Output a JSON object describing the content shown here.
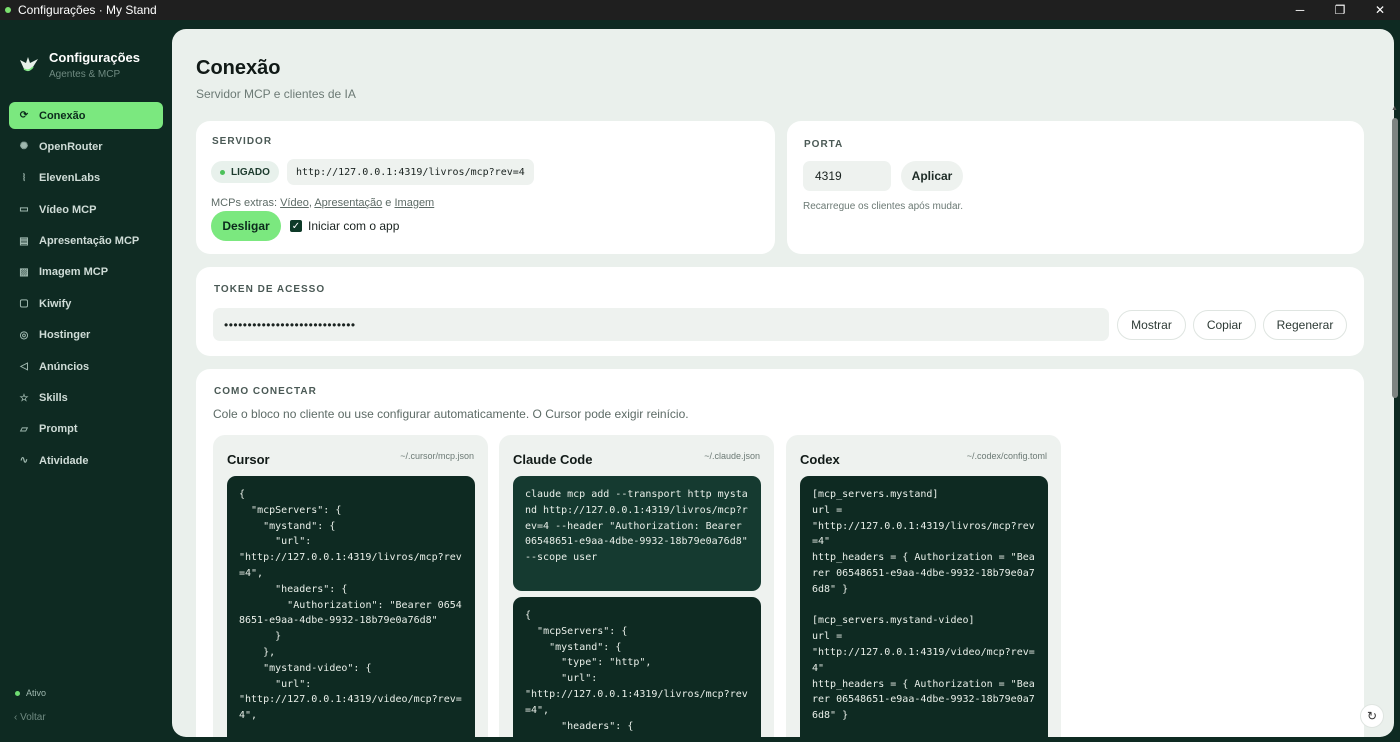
{
  "window": {
    "title": "Configurações · My Stand",
    "minimize": "─",
    "maximize": "❐",
    "close": "✕"
  },
  "brand": {
    "title": "Configurações",
    "subtitle": "Agentes & MCP"
  },
  "nav": [
    {
      "label": "Conexão",
      "icon": "link-icon",
      "glyph": "⟳"
    },
    {
      "label": "OpenRouter",
      "icon": "sun-icon",
      "glyph": "✺"
    },
    {
      "label": "ElevenLabs",
      "icon": "waveform-icon",
      "glyph": "⦚"
    },
    {
      "label": "Vídeo MCP",
      "icon": "video-icon",
      "glyph": "▭"
    },
    {
      "label": "Apresentação MCP",
      "icon": "presentation-icon",
      "glyph": "▤"
    },
    {
      "label": "Imagem MCP",
      "icon": "image-icon",
      "glyph": "▨"
    },
    {
      "label": "Kiwify",
      "icon": "bag-icon",
      "glyph": "▢"
    },
    {
      "label": "Hostinger",
      "icon": "globe-icon",
      "glyph": "◎"
    },
    {
      "label": "Anúncios",
      "icon": "megaphone-icon",
      "glyph": "◁"
    },
    {
      "label": "Skills",
      "icon": "star-icon",
      "glyph": "☆"
    },
    {
      "label": "Prompt",
      "icon": "chat-icon",
      "glyph": "▱"
    },
    {
      "label": "Atividade",
      "icon": "activity-icon",
      "glyph": "∿"
    }
  ],
  "status": {
    "label": "Ativo"
  },
  "back": {
    "label": "Voltar",
    "glyph": "‹"
  },
  "page": {
    "title": "Conexão",
    "subtitle": "Servidor MCP e clientes de IA"
  },
  "server": {
    "label": "SERVIDOR",
    "badge": "LIGADO",
    "url": "http://127.0.0.1:4319/livros/mcp?rev=4",
    "extras_prefix": "MCPs extras:",
    "extras_links": [
      "Vídeo",
      "Apresentação",
      "Imagem"
    ],
    "extras_sep1": ",",
    "extras_sep2": "e",
    "toggle_button": "Desligar",
    "start_with_app": "Iniciar com o app"
  },
  "port": {
    "label": "PORTA",
    "value": "4319",
    "apply": "Aplicar",
    "hint": "Recarregue os clientes após mudar."
  },
  "token": {
    "label": "TOKEN DE ACESSO",
    "value": "••••••••••••••••••••••••••••",
    "show": "Mostrar",
    "copy": "Copiar",
    "regenerate": "Regenerar"
  },
  "connect": {
    "label": "COMO CONECTAR",
    "subtitle": "Cole o bloco no cliente ou use configurar automaticamente. O Cursor pode exigir reinício.",
    "clients": [
      {
        "name": "Cursor",
        "path": "~/.cursor/mcp.json",
        "code": "{\n  \"mcpServers\": {\n    \"mystand\": {\n      \"url\":\n\"http://127.0.0.1:4319/livros/mcp?rev=4\",\n      \"headers\": {\n        \"Authorization\": \"Bearer 06548651-e9aa-4dbe-9932-18b79e0a76d8\"\n      }\n    },\n    \"mystand-video\": {\n      \"url\":\n\"http://127.0.0.1:4319/video/mcp?rev=4\","
      },
      {
        "name": "Claude Code",
        "path": "~/.claude.json",
        "code1": "claude mcp add --transport http mystand http://127.0.0.1:4319/livros/mcp?rev=4 --header \"Authorization: Bearer 06548651-e9aa-4dbe-9932-18b79e0a76d8\" --scope user",
        "code2": "{\n  \"mcpServers\": {\n    \"mystand\": {\n      \"type\": \"http\",\n      \"url\":\n\"http://127.0.0.1:4319/livros/mcp?rev=4\",\n      \"headers\": {"
      },
      {
        "name": "Codex",
        "path": "~/.codex/config.toml",
        "code": "[mcp_servers.mystand]\nurl =\n\"http://127.0.0.1:4319/livros/mcp?rev=4\"\nhttp_headers = { Authorization = \"Bearer 06548651-e9aa-4dbe-9932-18b79e0a76d8\" }\n\n[mcp_servers.mystand-video]\nurl =\n\"http://127.0.0.1:4319/video/mcp?rev=4\"\nhttp_headers = { Authorization = \"Bearer 06548651-e9aa-4dbe-9932-18b79e0a76d8\" }"
      }
    ]
  },
  "colors": {
    "accent": "#7be87f",
    "sidebar": "#0e2a22",
    "content_bg": "#eaf0ec",
    "code_bg": "#0e2a22"
  }
}
